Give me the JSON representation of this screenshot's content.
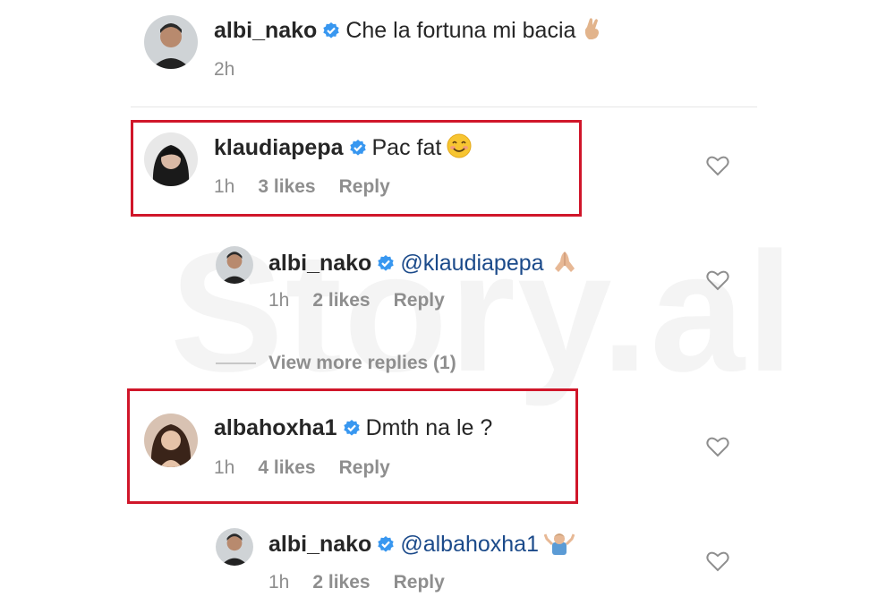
{
  "watermark": "Story.al",
  "comments": [
    {
      "username": "albi_nako",
      "text": "Che la fortuna mi bacia",
      "emoji": "crossed-fingers-emoji",
      "time": "2h"
    },
    {
      "username": "klaudiapepa",
      "text": "Pac fat",
      "emoji": "smiling-emoji",
      "time": "1h",
      "likes": "3 likes",
      "reply": "Reply"
    },
    {
      "username": "albi_nako",
      "text": "@klaudiapepa",
      "emoji": "folded-hands-emoji",
      "time": "1h",
      "likes": "2 likes",
      "reply": "Reply"
    },
    {
      "username": "albahoxha1",
      "text": "Dmth na le ?",
      "time": "1h",
      "likes": "4 likes",
      "reply": "Reply"
    },
    {
      "username": "albi_nako",
      "text": "@albahoxha1",
      "emoji": "shrug-emoji",
      "time": "1h",
      "likes": "2 likes",
      "reply": "Reply"
    }
  ],
  "view_more": "View more replies (1)",
  "colors": {
    "highlight": "#d0162a",
    "verified": "#3897f0",
    "mention": "#1b4a8a",
    "muted": "#8e8e8e"
  }
}
